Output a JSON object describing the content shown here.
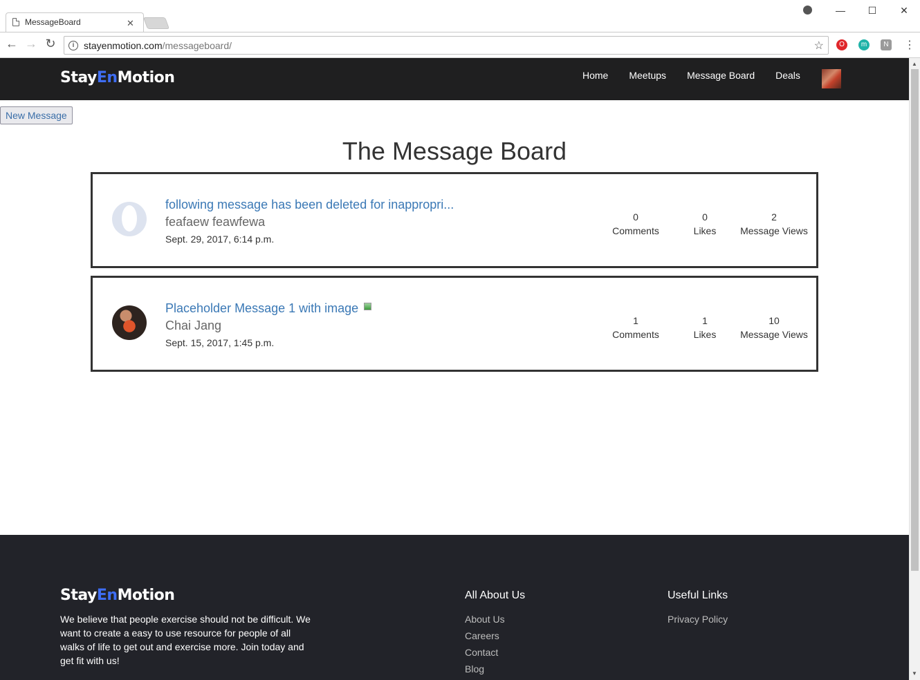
{
  "browser": {
    "tab_title": "MessageBoard",
    "url_host": "stayenmotion.com",
    "url_path": "/messageboard/"
  },
  "site": {
    "logo_part1": "Stay",
    "logo_part2": "En",
    "logo_part3": "Motion",
    "nav": [
      "Home",
      "Meetups",
      "Message Board",
      "Deals"
    ]
  },
  "board": {
    "new_message_label": "New Message",
    "title": "The Message Board",
    "messages": [
      {
        "title": "following message has been deleted for inappropri...",
        "author": "feafaew feawfewa",
        "date": "Sept. 29, 2017, 6:14 p.m.",
        "comments": "0",
        "comments_label": "Comments",
        "likes": "0",
        "likes_label": "Likes",
        "views": "2",
        "views_label": "Message Views"
      },
      {
        "title": "Placeholder Message 1 with image",
        "author": "Chai Jang",
        "date": "Sept. 15, 2017, 1:45 p.m.",
        "comments": "1",
        "comments_label": "Comments",
        "likes": "1",
        "likes_label": "Likes",
        "views": "10",
        "views_label": "Message Views"
      }
    ]
  },
  "footer": {
    "about_text": "We believe that people exercise should not be difficult. We want to create a easy to use resource for people of all walks of life to get out and exercise more. Join today and get fit with us!",
    "col1_heading": "All About Us",
    "col1_links": [
      "About Us",
      "Careers",
      "Contact",
      "Blog"
    ],
    "col2_heading": "Useful Links",
    "col2_links": [
      "Privacy Policy"
    ]
  }
}
